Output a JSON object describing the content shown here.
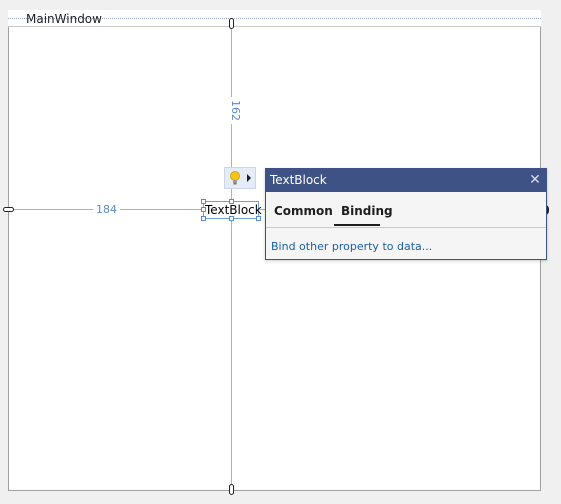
{
  "window": {
    "title": "MainWindow"
  },
  "textblock": {
    "text": "TextBlock"
  },
  "dimensions": {
    "top_margin": "162",
    "left_margin": "184"
  },
  "popup": {
    "title": "TextBlock",
    "close_glyph": "✕",
    "tabs": [
      {
        "label": "Common",
        "selected": false
      },
      {
        "label": "Binding",
        "selected": true
      }
    ],
    "link": "Bind other property to data..."
  },
  "colors": {
    "popup_header": "#3f5285",
    "guide": "#9db4d6",
    "dimension_label": "#5b8ad0",
    "link": "#1a5ea8"
  },
  "icons": {
    "quick_action": "lightbulb-icon",
    "expand": "arrow-right-icon"
  }
}
